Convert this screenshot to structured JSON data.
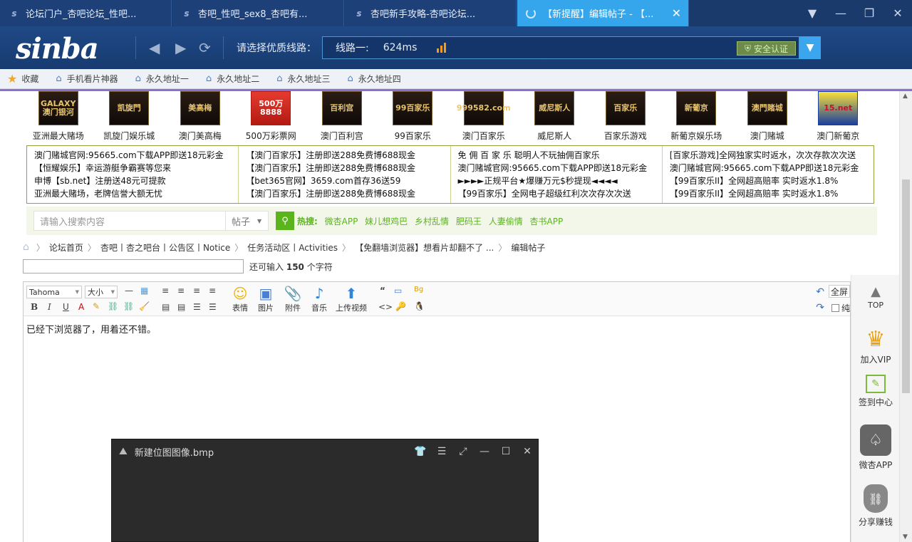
{
  "tabs": [
    {
      "title": "论坛门户_杏吧论坛_性吧...",
      "active": false
    },
    {
      "title": "杏吧_性吧_sex8_杏吧有...",
      "active": false
    },
    {
      "title": "杏吧新手攻略-杏吧论坛...",
      "active": false
    },
    {
      "title": "【新提醒】编辑帖子 - 【...",
      "active": true
    }
  ],
  "nav": {
    "logo": "sinba",
    "route_label": "请选择优质线路：",
    "route_name": "线路一:",
    "latency": "624ms",
    "safe_label": "安全认证"
  },
  "favorites": [
    {
      "label": "收藏",
      "icon": "star-icon"
    },
    {
      "label": "手机看片神器",
      "icon": "home-icon"
    },
    {
      "label": "永久地址一",
      "icon": "home-icon"
    },
    {
      "label": "永久地址二",
      "icon": "home-icon"
    },
    {
      "label": "永久地址三",
      "icon": "home-icon"
    },
    {
      "label": "永久地址四",
      "icon": "home-icon"
    }
  ],
  "casino_logos": [
    {
      "name": "亚洲最大赌场",
      "img": "GALAXY 澳门银河"
    },
    {
      "name": "凯旋门娱乐城",
      "img": "凯旋門"
    },
    {
      "name": "澳门美高梅",
      "img": "美高梅"
    },
    {
      "name": "500万彩票网",
      "img": "500万 8888"
    },
    {
      "name": "澳门百利宫",
      "img": "百利宫"
    },
    {
      "name": "99百家乐",
      "img": "99百家乐"
    },
    {
      "name": "澳门百家乐",
      "img": "999582.com"
    },
    {
      "name": "威尼斯人",
      "img": "威尼斯人"
    },
    {
      "name": "百家乐游戏",
      "img": "百家乐"
    },
    {
      "name": "新葡京娱乐场",
      "img": "新葡京"
    },
    {
      "name": "澳门赌城",
      "img": "澳門賭城"
    },
    {
      "name": "澳门新葡京",
      "img": "15.net"
    }
  ],
  "ad_columns": [
    [
      "澳门赌城官网:95665.com下载APP即送18元彩金",
      "【恒耀娱乐】幸运游艇争霸赛等您来",
      "申博【sb.net】注册送48元可提款",
      "亚洲最大赌场，老牌信誉大额无忧"
    ],
    [
      "【澳门百家乐】注册即送288免费博688现金",
      "【澳门百家乐】注册即送288免费博688现金",
      "【bet365官网】3659.com首存36送59",
      "【澳门百家乐】注册即送288免费博688现金"
    ],
    [
      "免 佣 百 家 乐 聪明人不玩抽佣百家乐",
      "澳门赌城官网:95665.com下载APP即送18元彩金",
      "►►►►正规平台★爆赚万元$秒提现◄◄◄◄",
      "【99百家乐】全网电子超级红利次次存次次送"
    ],
    [
      "[百家乐游戏]全网独家实时返水，次次存款次次送",
      "澳门赌城官网:95665.com下载APP即送18元彩金",
      "【99百家乐II】全网超高赔率 实时返水1.8%",
      "【99百家乐II】全网超高赔率 实时返水1.8%"
    ]
  ],
  "search": {
    "placeholder": "请输入搜索内容",
    "type": "帖子",
    "hot_label": "热搜:",
    "hot_items": [
      "微杏APP",
      "妹儿想鸡巴",
      "乡村乱情",
      "肥码王",
      "人妻偷情",
      "杏书APP"
    ]
  },
  "breadcrumb": [
    "论坛首页",
    "杏吧丨杏之吧台丨公告区丨Notice",
    "任务活动区丨Activities",
    "【免翻墙浏览器】想看片却翻不了 ...",
    "编辑帖子"
  ],
  "subject": {
    "value": "",
    "count_prefix": "还可输入",
    "count_value": "150",
    "count_suffix": "个字符"
  },
  "editor": {
    "font": "Tahoma",
    "size": "大小",
    "tools_big": [
      "表情",
      "图片",
      "附件",
      "音乐",
      "上传视频"
    ],
    "fullscreen": "全屏",
    "pure": "纯",
    "body": "已经下浏览器了，用着还不错。"
  },
  "sidebar": [
    "TOP",
    "加入VIP",
    "签到中心",
    "微杏APP",
    "分享赚钱"
  ],
  "viewer": {
    "title": "新建位图图像.bmp"
  },
  "colors": {
    "tab_active": "#35a5ec",
    "nav_bg": "#1f4986",
    "hot_green": "#5ab41b",
    "ad_border": "#8ea33c"
  }
}
